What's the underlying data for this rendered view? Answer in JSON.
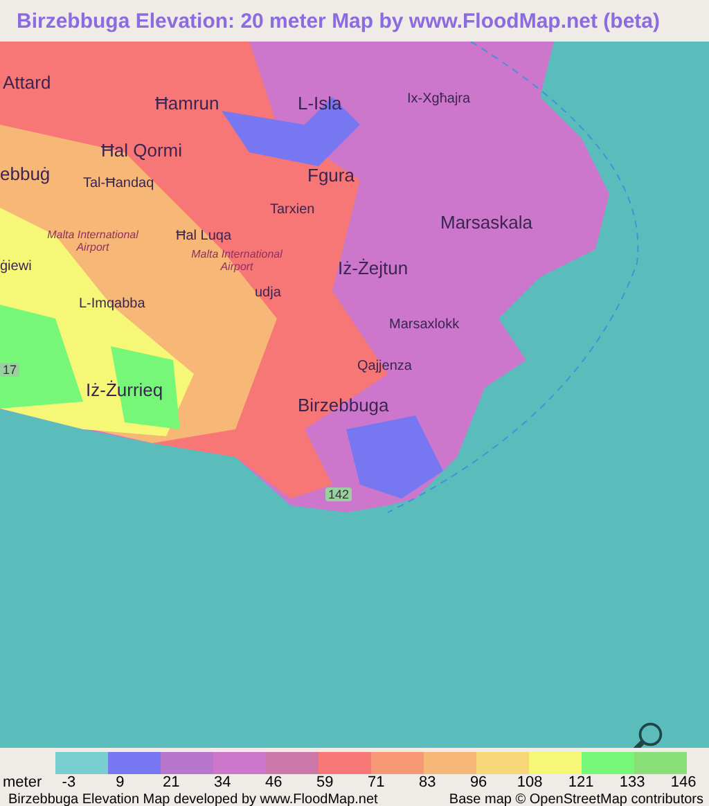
{
  "title": "Birzebbuga Elevation: 20 meter Map by www.FloodMap.net (beta)",
  "map": {
    "labels": [
      {
        "text": "Attard",
        "kind": "town"
      },
      {
        "text": "Ħamrun",
        "kind": "town"
      },
      {
        "text": "L-Isla",
        "kind": "town"
      },
      {
        "text": "Ix-Xgħajra",
        "kind": "small"
      },
      {
        "text": "Ħal Qormi",
        "kind": "town"
      },
      {
        "text": "ebbuġ",
        "kind": "town"
      },
      {
        "text": "Tal-Ħandaq",
        "kind": "small"
      },
      {
        "text": "Fgura",
        "kind": "town"
      },
      {
        "text": "Tarxien",
        "kind": "small"
      },
      {
        "text": "Marsaskala",
        "kind": "town"
      },
      {
        "text": "Ħal Luqa",
        "kind": "small"
      },
      {
        "text": "Malta International Airport",
        "kind": "airport"
      },
      {
        "text": "ġiewi",
        "kind": "small"
      },
      {
        "text": "Malta International Airport",
        "kind": "airport"
      },
      {
        "text": "Iż-Żejtun",
        "kind": "town"
      },
      {
        "text": "udja",
        "kind": "small"
      },
      {
        "text": "L-Imqabba",
        "kind": "small"
      },
      {
        "text": "Marsaxlokk",
        "kind": "small"
      },
      {
        "text": "Qajjenza",
        "kind": "small"
      },
      {
        "text": "17",
        "kind": "road"
      },
      {
        "text": "Iż-Żurrieq",
        "kind": "town"
      },
      {
        "text": "Birzebbuga",
        "kind": "town"
      },
      {
        "text": "142",
        "kind": "road"
      }
    ]
  },
  "legend": {
    "unit": "meter",
    "swatches": [
      {
        "color": "#78cfcf",
        "label": "-3"
      },
      {
        "color": "#7777f2",
        "label": "9"
      },
      {
        "color": "#b877cc",
        "label": "21"
      },
      {
        "color": "#cc77cc",
        "label": "34"
      },
      {
        "color": "#cc77aa",
        "label": "46"
      },
      {
        "color": "#f77777",
        "label": "59"
      },
      {
        "color": "#f79977",
        "label": "71"
      },
      {
        "color": "#f7b777",
        "label": "83"
      },
      {
        "color": "#f7d777",
        "label": "96"
      },
      {
        "color": "#f7f777",
        "label": "108"
      },
      {
        "color": "#77f777",
        "label": "121"
      },
      {
        "color": "#88e077",
        "label": "133"
      }
    ],
    "last_label": "146"
  },
  "footer": {
    "left": "Birzebbuga Elevation Map developed by www.FloodMap.net",
    "right": "Base map © OpenStreetMap contributors"
  }
}
